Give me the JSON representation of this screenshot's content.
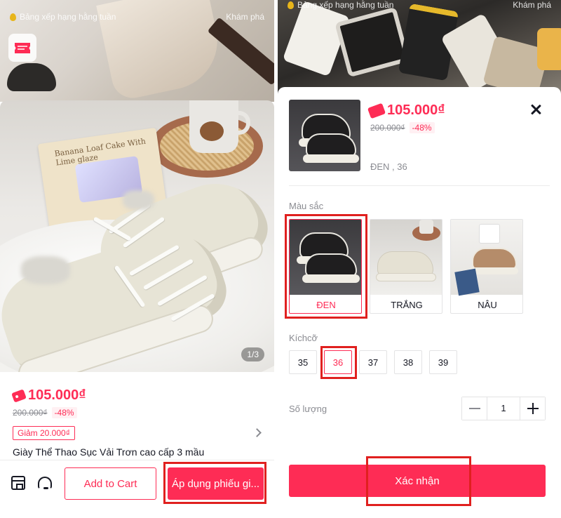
{
  "left": {
    "ranking_label": "Bảng xếp hạng hằng tuần",
    "explore_label": "Khám phá",
    "image_counter": "1/3",
    "book_title": "Banana Loaf Cake With Lime glaze",
    "price": "105.000₫",
    "old_price": "200.000₫",
    "discount": "-48%",
    "coupon": "Giảm 20.000₫",
    "product_title": "Giày Thể Thao Sục Vải Trơn cao cấp 3 mầu",
    "add_to_cart": "Add to Cart",
    "apply_voucher": "Áp dụng phiếu gi..."
  },
  "right": {
    "ranking_label": "Bảng xếp hạng hằng tuần",
    "explore_label": "Khám phá",
    "price": "105.000₫",
    "old_price": "200.000₫",
    "discount": "-48%",
    "selected_variant": "ĐEN , 36",
    "color_label": "Màu sắc",
    "colors": [
      {
        "label": "ĐEN",
        "selected": true
      },
      {
        "label": "TRẮNG",
        "selected": false
      },
      {
        "label": "NÂU",
        "selected": false
      }
    ],
    "size_label": "Kíchcỡ",
    "sizes": [
      "35",
      "36",
      "37",
      "38",
      "39"
    ],
    "selected_size": "36",
    "quantity_label": "Số lượng",
    "quantity": "1",
    "confirm": "Xác nhận"
  },
  "colors": {
    "accent": "#fe2c55",
    "highlight_box": "#e0201f",
    "muted_text": "#8a8b91"
  }
}
